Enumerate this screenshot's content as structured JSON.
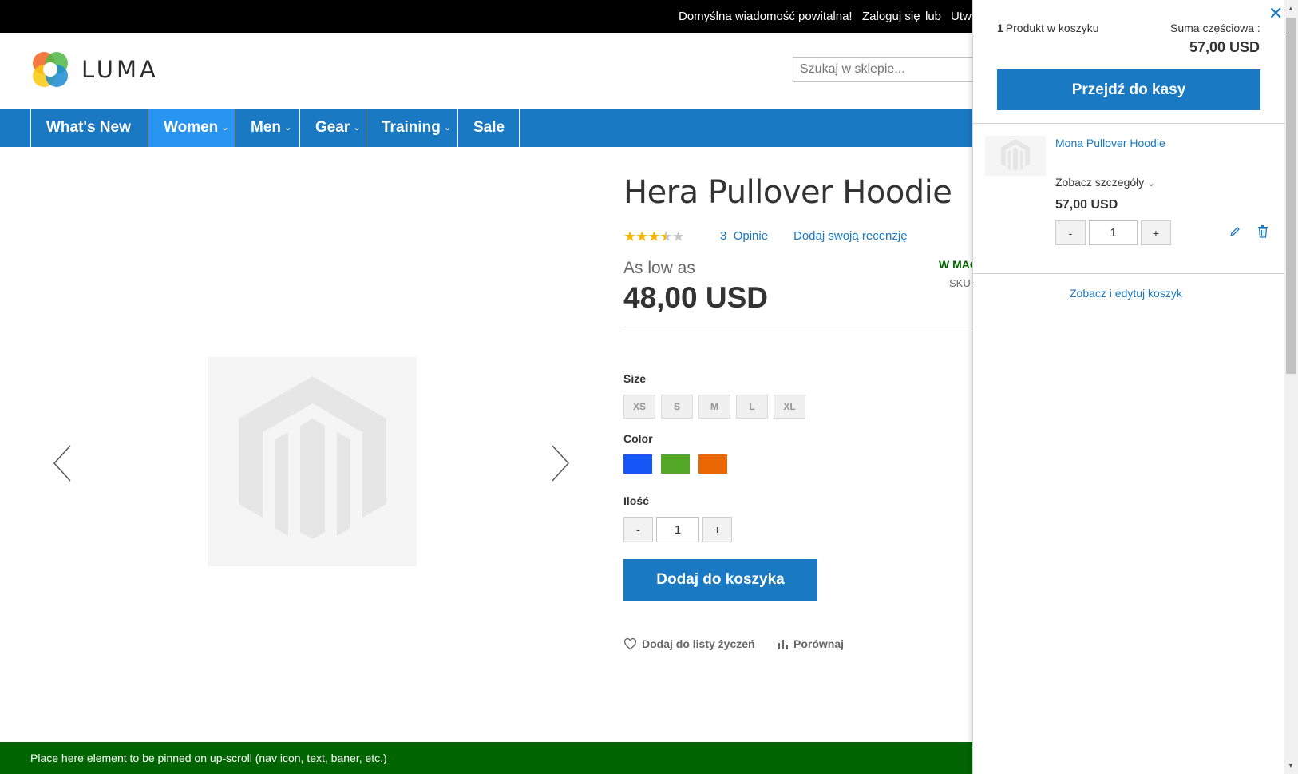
{
  "topbar": {
    "welcome": "Domyślna wiadomość powitalna!",
    "login": "Zaloguj się",
    "or": "lub",
    "create": "Utwórz konto"
  },
  "header": {
    "logo_text": "LUMA",
    "search_placeholder": "Szukaj w sklepie..."
  },
  "nav": {
    "items": [
      {
        "label": "What's New",
        "dropdown": false
      },
      {
        "label": "Women",
        "dropdown": true,
        "active": true
      },
      {
        "label": "Men",
        "dropdown": true
      },
      {
        "label": "Gear",
        "dropdown": true
      },
      {
        "label": "Training",
        "dropdown": true
      },
      {
        "label": "Sale",
        "dropdown": false
      }
    ]
  },
  "product": {
    "title": "Hera Pullover Hoodie",
    "rating_stars": 3.5,
    "reviews_count": "3",
    "reviews_label": "Opinie",
    "add_review": "Dodaj swoją recenzję",
    "as_low_as": "As low as",
    "price": "48,00 USD",
    "stock": "W MAGAZYNIE",
    "sku_label": "SKU:",
    "size_label": "Size",
    "sizes": [
      "XS",
      "S",
      "M",
      "L",
      "XL"
    ],
    "color_label": "Color",
    "colors": [
      "#1857f7",
      "#53a828",
      "#eb6703"
    ],
    "qty_label": "Ilość",
    "qty_value": "1",
    "qty_minus": "-",
    "qty_plus": "+",
    "add_to_cart": "Dodaj do koszyka",
    "wishlist": "Dodaj do listy życzeń",
    "compare": "Porównaj"
  },
  "footer_bar": {
    "text": "Place here element to be pinned on up-scroll (nav icon, text, baner, etc.)"
  },
  "minicart": {
    "count": "1",
    "count_label": "Produkt w koszyku",
    "subtotal_label": "Suma częściowa :",
    "subtotal": "57,00 USD",
    "checkout": "Przejdź do kasy",
    "item": {
      "name": "Mona Pullover Hoodie",
      "details": "Zobacz szczegóły",
      "price": "57,00 USD",
      "qty": "1",
      "minus": "-",
      "plus": "+"
    },
    "view_cart": "Zobacz i edytuj koszyk"
  },
  "colors": {
    "brand_blue": "#1979c3",
    "nav_active": "#2896f0",
    "stock_green": "#006400"
  }
}
